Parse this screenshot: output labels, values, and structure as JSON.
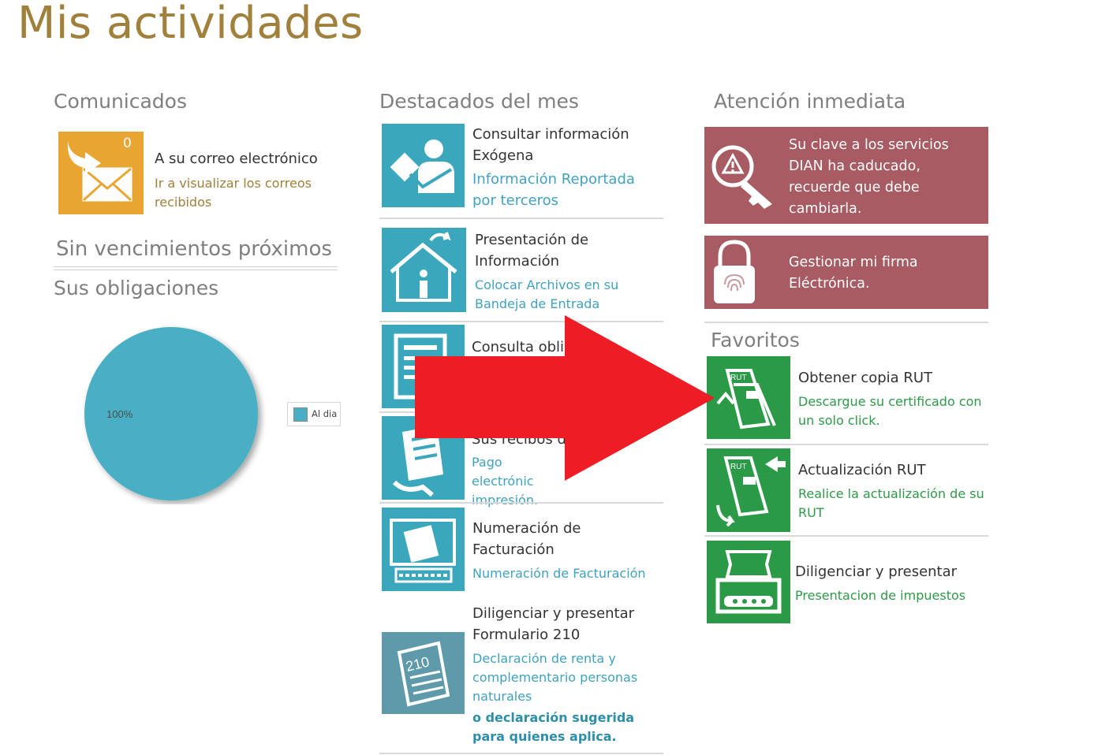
{
  "page": {
    "title": "Mis actividades"
  },
  "comunicados": {
    "heading": "Comunicados",
    "count": "0",
    "title": "A su correo electrónico",
    "link": "Ir a visualizar los correos recibidos",
    "tile_color": "#e9a532"
  },
  "vencimientos": {
    "heading": "Sin vencimientos próximos"
  },
  "obligaciones": {
    "heading": "Sus obligaciones",
    "chart_data": {
      "type": "pie",
      "slices": [
        {
          "label": "Al dia",
          "value": 100,
          "display": "100%",
          "color": "#4aafc4"
        }
      ],
      "legend_position": "right"
    }
  },
  "destacados": {
    "heading": "Destacados del mes",
    "items": [
      {
        "title": "Consultar información Exógena",
        "link": "Información Reportada por terceros",
        "icon": "person-document-icon"
      },
      {
        "title": "Presentación de Información",
        "link": "Colocar Archivos en su Bandeja de Entrada",
        "icon": "house-info-icon"
      },
      {
        "title": "Consulta obli",
        "link": "",
        "icon": "document-list-icon"
      },
      {
        "title": "Sus recibos d",
        "link": "Pago electrónic impresión.",
        "icon": "receipt-icon"
      },
      {
        "title": "Numeración de Facturación",
        "link": "Numeración de Facturación",
        "icon": "invoice-keyboard-icon"
      },
      {
        "title": "Diligenciar y presentar Formulario 210",
        "link": "Declaración de renta y complementario personas naturales",
        "link2": "o declaración sugerida para quienes aplica.",
        "icon": "form-210-icon"
      }
    ],
    "tile_color": "#3aa7bd"
  },
  "atencion": {
    "heading": "Atención inmediata",
    "items": [
      {
        "text": "Su clave a los servicios DIAN ha caducado, recuerde que debe cambiarla.",
        "icon": "warning-key-icon"
      },
      {
        "text": "Gestionar mi firma Eléctrónica.",
        "icon": "fingerprint-lock-icon"
      }
    ],
    "box_color": "#a85b62"
  },
  "favoritos": {
    "heading": "Favoritos",
    "items": [
      {
        "title": "Obtener copia RUT",
        "link": "Descargue su certificado con un solo click.",
        "icon": "rut-copy-icon"
      },
      {
        "title": "Actualización RUT",
        "link": "Realice la actualización de su RUT",
        "icon": "rut-update-icon"
      },
      {
        "title": "Diligenciar y presentar",
        "link": "Presentacion de impuestos",
        "icon": "tax-machine-icon"
      }
    ],
    "tile_color": "#2b9a47"
  },
  "overlay": {
    "arrow_color": "#ee1c25",
    "icon": "red-arrow-right-icon"
  }
}
